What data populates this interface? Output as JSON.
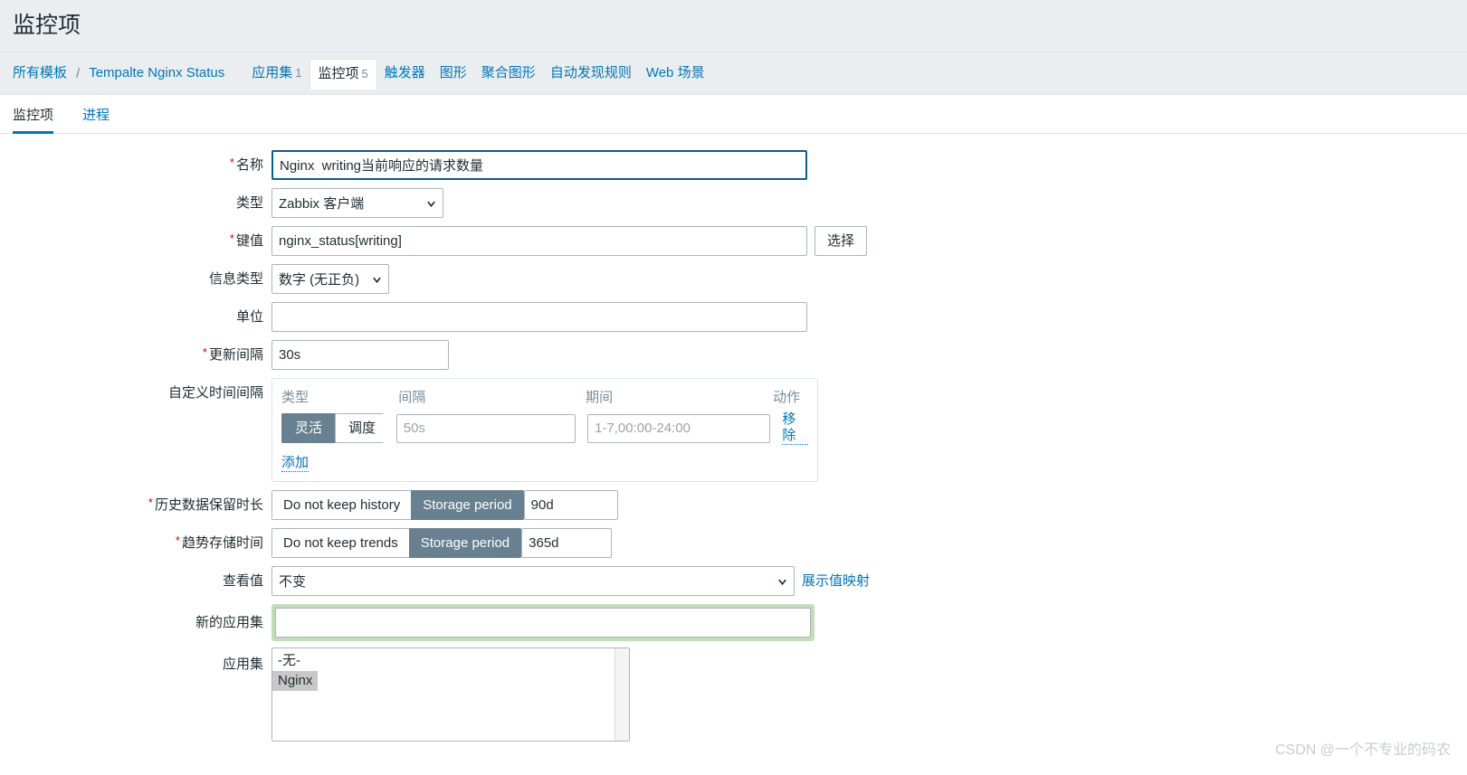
{
  "page": {
    "title": "监控项",
    "watermark": "CSDN @一个不专业的码农"
  },
  "breadcrumb": {
    "all_templates": "所有模板",
    "separator": "/",
    "template_name": "Tempalte Nginx Status",
    "tabs": [
      {
        "label": "应用集",
        "count": "1",
        "selected": false
      },
      {
        "label": "监控项",
        "count": "5",
        "selected": true
      },
      {
        "label": "触发器",
        "count": "",
        "selected": false
      },
      {
        "label": "图形",
        "count": "",
        "selected": false
      },
      {
        "label": "聚合图形",
        "count": "",
        "selected": false
      },
      {
        "label": "自动发现规则",
        "count": "",
        "selected": false
      },
      {
        "label": "Web 场景",
        "count": "",
        "selected": false
      }
    ]
  },
  "subtabs": [
    {
      "label": "监控项",
      "active": true
    },
    {
      "label": "进程",
      "active": false
    }
  ],
  "form": {
    "name": {
      "label": "名称",
      "required": true,
      "value": "Nginx  writing当前响应的请求数量",
      "placeholder": ""
    },
    "type": {
      "label": "类型",
      "required": false,
      "value": "Zabbix 客户端"
    },
    "key": {
      "label": "键值",
      "required": true,
      "value": "nginx_status[writing]",
      "placeholder": "",
      "select_button": "选择"
    },
    "value_type": {
      "label": "信息类型",
      "required": false,
      "value": "数字 (无正负)"
    },
    "units": {
      "label": "单位",
      "required": false,
      "value": "",
      "placeholder": ""
    },
    "update_interval": {
      "label": "更新间隔",
      "required": true,
      "value": "30s",
      "placeholder": ""
    },
    "custom_intervals": {
      "label": "自定义时间间隔",
      "required": false,
      "headers": {
        "type": "类型",
        "interval": "间隔",
        "period": "期间",
        "action": "动作"
      },
      "rows": [
        {
          "type_options": [
            "灵活",
            "调度"
          ],
          "type_selected": "灵活",
          "interval_value": "",
          "interval_placeholder": "50s",
          "period_value": "",
          "period_placeholder": "1-7,00:00-24:00",
          "remove_label": "移除"
        }
      ],
      "add_label": "添加"
    },
    "history": {
      "label": "历史数据保留时长",
      "required": true,
      "options": [
        "Do not keep history",
        "Storage period"
      ],
      "selected": "Storage period",
      "value": "90d"
    },
    "trends": {
      "label": "趋势存储时间",
      "required": true,
      "options": [
        "Do not keep trends",
        "Storage period"
      ],
      "selected": "Storage period",
      "value": "365d"
    },
    "show_value": {
      "label": "查看值",
      "required": false,
      "value": "不变",
      "mapping_link": "展示值映射"
    },
    "new_application": {
      "label": "新的应用集",
      "required": false,
      "value": "",
      "placeholder": ""
    },
    "applications": {
      "label": "应用集",
      "required": false,
      "options": [
        {
          "label": "-无-",
          "selected": false
        },
        {
          "label": "Nginx",
          "selected": true
        }
      ]
    }
  },
  "colors": {
    "accent_link": "#0275b8",
    "toggle_active_bg": "#68808f",
    "required_star": "#d40000",
    "green_focus": "#c3dcb9",
    "list_selected_bg": "#c8c8c8",
    "header_bg": "#ebeef0"
  }
}
